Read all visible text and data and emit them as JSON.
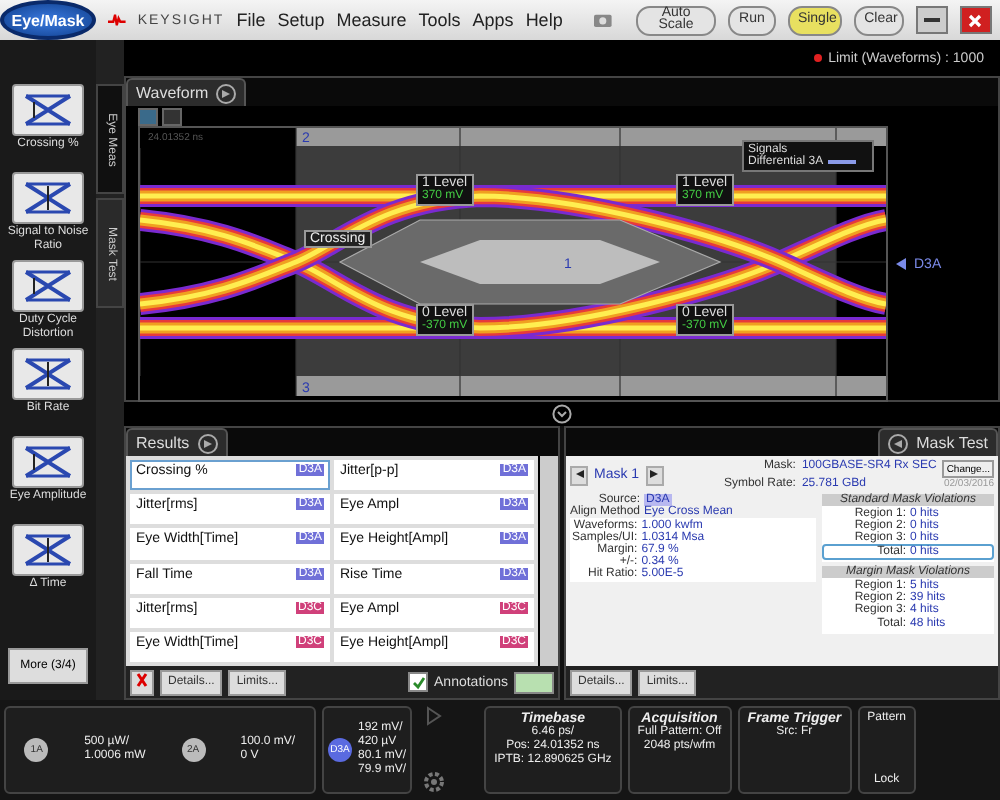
{
  "app_button": "Eye/Mask",
  "brand": "KEYSIGHT",
  "menu": [
    "File",
    "Setup",
    "Measure",
    "Tools",
    "Apps",
    "Help"
  ],
  "toolbar_buttons": [
    {
      "label": "Auto Scale",
      "selected": false
    },
    {
      "label": "Run",
      "selected": false
    },
    {
      "label": "Single",
      "selected": true
    },
    {
      "label": "Clear",
      "selected": false
    }
  ],
  "limit_status": "Limit (Waveforms) : 1000",
  "sidebar_tools": [
    "Crossing %",
    "Signal to Noise Ratio",
    "Duty Cycle Distortion",
    "Bit Rate",
    "Eye Amplitude",
    "Δ Time"
  ],
  "more_button": "More (3/4)",
  "side_tabs": [
    {
      "label": "Eye Meas",
      "selected": true
    },
    {
      "label": "Mask Test",
      "selected": false
    }
  ],
  "waveform": {
    "tab": "Waveform",
    "timestamp": "24.01352 ns",
    "regions": [
      "2",
      "1",
      "3"
    ],
    "crossing": "Crossing",
    "levels": [
      {
        "label": "1 Level",
        "value": "370 mV"
      },
      {
        "label": "1 Level",
        "value": "370 mV"
      },
      {
        "label": "0 Level",
        "value": "-370 mV"
      },
      {
        "label": "0 Level",
        "value": "-370 mV"
      }
    ],
    "signals_title": "Signals",
    "signal": "Differential 3A",
    "channel": "D3A"
  },
  "results": {
    "tab": "Results",
    "cells": [
      {
        "name": "Crossing %",
        "source": "D3A",
        "color": "#7070d8",
        "selected": true
      },
      {
        "name": "Jitter[p-p]",
        "source": "D3A",
        "color": "#7070d8",
        "selected": false
      },
      {
        "name": "Jitter[rms]",
        "source": "D3A",
        "color": "#7070d8",
        "selected": false
      },
      {
        "name": "Eye Ampl",
        "source": "D3A",
        "color": "#7070d8",
        "selected": false
      },
      {
        "name": "Eye Width[Time]",
        "source": "D3A",
        "color": "#7070d8",
        "selected": false
      },
      {
        "name": "Eye Height[Ampl]",
        "source": "D3A",
        "color": "#7070d8",
        "selected": false
      },
      {
        "name": "Fall Time",
        "source": "D3A",
        "color": "#7070d8",
        "selected": false
      },
      {
        "name": "Rise Time",
        "source": "D3A",
        "color": "#7070d8",
        "selected": false
      },
      {
        "name": "Jitter[rms]",
        "source": "D3C",
        "color": "#d0407a",
        "selected": false
      },
      {
        "name": "Eye Ampl",
        "source": "D3C",
        "color": "#d0407a",
        "selected": false
      },
      {
        "name": "Eye Width[Time]",
        "source": "D3C",
        "color": "#d0407a",
        "selected": false
      },
      {
        "name": "Eye Height[Ampl]",
        "source": "D3C",
        "color": "#d0407a",
        "selected": false
      }
    ],
    "buttons": [
      "Details...",
      "Limits..."
    ],
    "annotations": {
      "label": "Annotations",
      "checked": true
    }
  },
  "mask": {
    "tab": "Mask Test",
    "name": "Mask 1",
    "mask_label": "Mask:",
    "mask_value": "100GBASE-SR4 Rx SEC",
    "change": "Change...",
    "rate_label": "Symbol Rate:",
    "rate_value": "25.781 GBd",
    "date": "02/03/2016",
    "info": [
      {
        "label": "Source:",
        "value": "D3A"
      },
      {
        "label": "Align Method",
        "value": "Eye Cross Mean"
      }
    ],
    "stats": [
      {
        "label": "Waveforms:",
        "value": "1.000 kwfm"
      },
      {
        "label": "Samples/UI:",
        "value": "1.0314 Msa"
      },
      {
        "label": "Margin:",
        "value": "67.9 %"
      },
      {
        "label": "+/-:",
        "value": "0.34 %"
      },
      {
        "label": "Hit Ratio:",
        "value": "5.00E-5"
      }
    ],
    "groups": [
      {
        "title": "Standard Mask Violations",
        "rows": [
          {
            "label": "Region 1:",
            "value": "0 hits"
          },
          {
            "label": "Region 2:",
            "value": "0 hits"
          },
          {
            "label": "Region 3:",
            "value": "0 hits"
          }
        ],
        "total_label": "Total:",
        "total": "0 hits",
        "selected": true
      },
      {
        "title": "Margin Mask Violations",
        "rows": [
          {
            "label": "Region 1:",
            "value": "5 hits"
          },
          {
            "label": "Region 2:",
            "value": "39 hits"
          },
          {
            "label": "Region 3:",
            "value": "4 hits"
          }
        ],
        "total_label": "Total:",
        "total": "48 hits",
        "selected": false
      }
    ],
    "buttons": [
      "Details...",
      "Limits..."
    ]
  },
  "channels": [
    {
      "badge": "1A",
      "lines": [
        "500 µW/",
        "1.0006 mW"
      ]
    },
    {
      "badge": "2A",
      "lines": [
        "100.0 mV/",
        "0 V"
      ]
    },
    {
      "badge": "D3A",
      "lines": [
        "192 mV/",
        "420 µV",
        "80.1 mV/",
        "79.9 mV/"
      ]
    }
  ],
  "status": [
    {
      "title": "Timebase",
      "lines": [
        "6.46 ps/",
        "Pos: 24.01352 ns",
        "IPTB: 12.890625 GHz"
      ]
    },
    {
      "title": "Acquisition",
      "lines": [
        "Full Pattern: Off",
        "2048 pts/wfm"
      ]
    },
    {
      "title": "Frame Trigger",
      "lines": [
        "Src: Fr"
      ]
    }
  ],
  "pattern": {
    "title": "Pattern",
    "value": "Lock"
  }
}
